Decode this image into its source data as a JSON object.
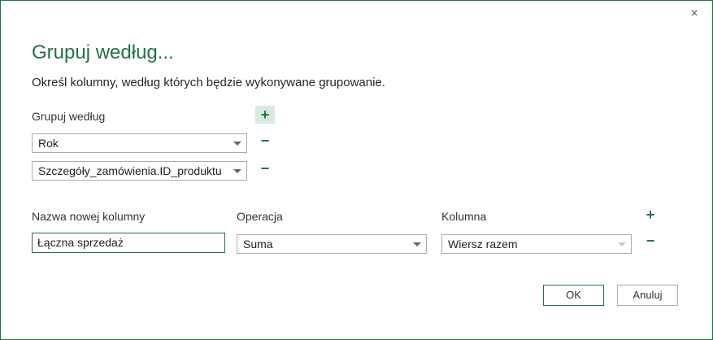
{
  "dialog": {
    "title": "Grupuj według...",
    "description": "Określ kolumny, według których będzie wykonywane grupowanie.",
    "close_symbol": "×"
  },
  "group_by": {
    "label": "Grupuj według",
    "add_symbol": "+",
    "remove_symbol": "−",
    "rows": [
      {
        "value": "Rok"
      },
      {
        "value": "Szczegóły_zamówienia.ID_produktu"
      }
    ]
  },
  "aggregation": {
    "new_column_label": "Nazwa nowej kolumny",
    "operation_label": "Operacja",
    "column_label": "Kolumna",
    "add_symbol": "+",
    "remove_symbol": "−",
    "new_column_value": "Łączna sprzedaż",
    "operation_value": "Suma",
    "column_value": "Wiersz razem"
  },
  "buttons": {
    "ok_label": "OK",
    "cancel_label": "Anuluj"
  },
  "colors": {
    "accent": "#217346",
    "border": "#ababab"
  },
  "icons": {
    "close": "close-icon",
    "add": "plus-icon",
    "remove": "minus-icon",
    "dropdown": "chevron-down-icon"
  }
}
